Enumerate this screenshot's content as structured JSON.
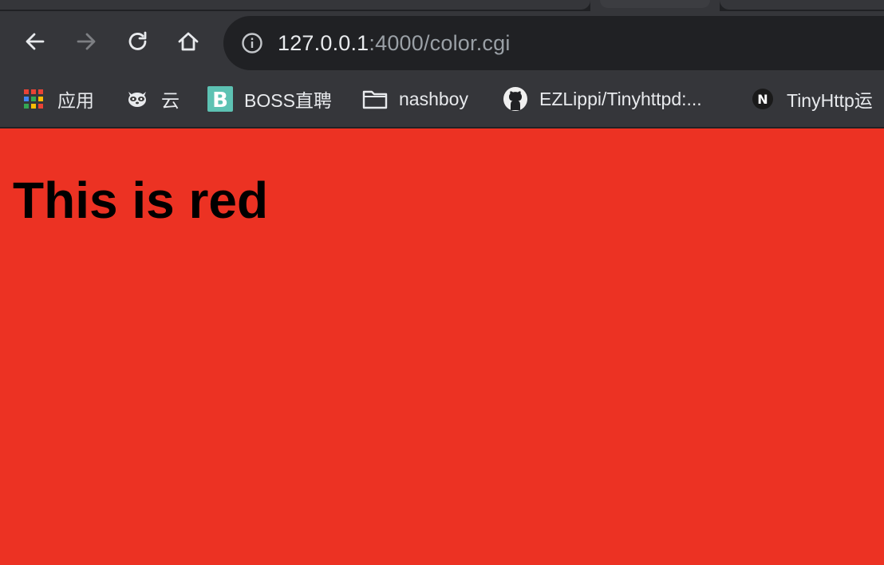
{
  "toolbar": {
    "url_host": "127.0.0.1",
    "url_path": ":4000/color.cgi",
    "icons": [
      "back-icon",
      "forward-icon",
      "reload-icon",
      "home-icon",
      "info-icon"
    ]
  },
  "bookmarks": [
    {
      "label": "应用",
      "icon": "apps-grid-icon"
    },
    {
      "label": "云",
      "icon": "raccoon-icon"
    },
    {
      "label": "BOSS直聘",
      "icon": "boss-icon"
    },
    {
      "label": "nashboy",
      "icon": "folder-icon"
    },
    {
      "label": "EZLippi/Tinyhttpd:...",
      "icon": "github-icon"
    },
    {
      "label": "TinyHttp运",
      "icon": "nextjs-icon"
    }
  ],
  "page": {
    "heading": "This is red",
    "background_color": "#ec3223",
    "text_color": "#000000"
  }
}
